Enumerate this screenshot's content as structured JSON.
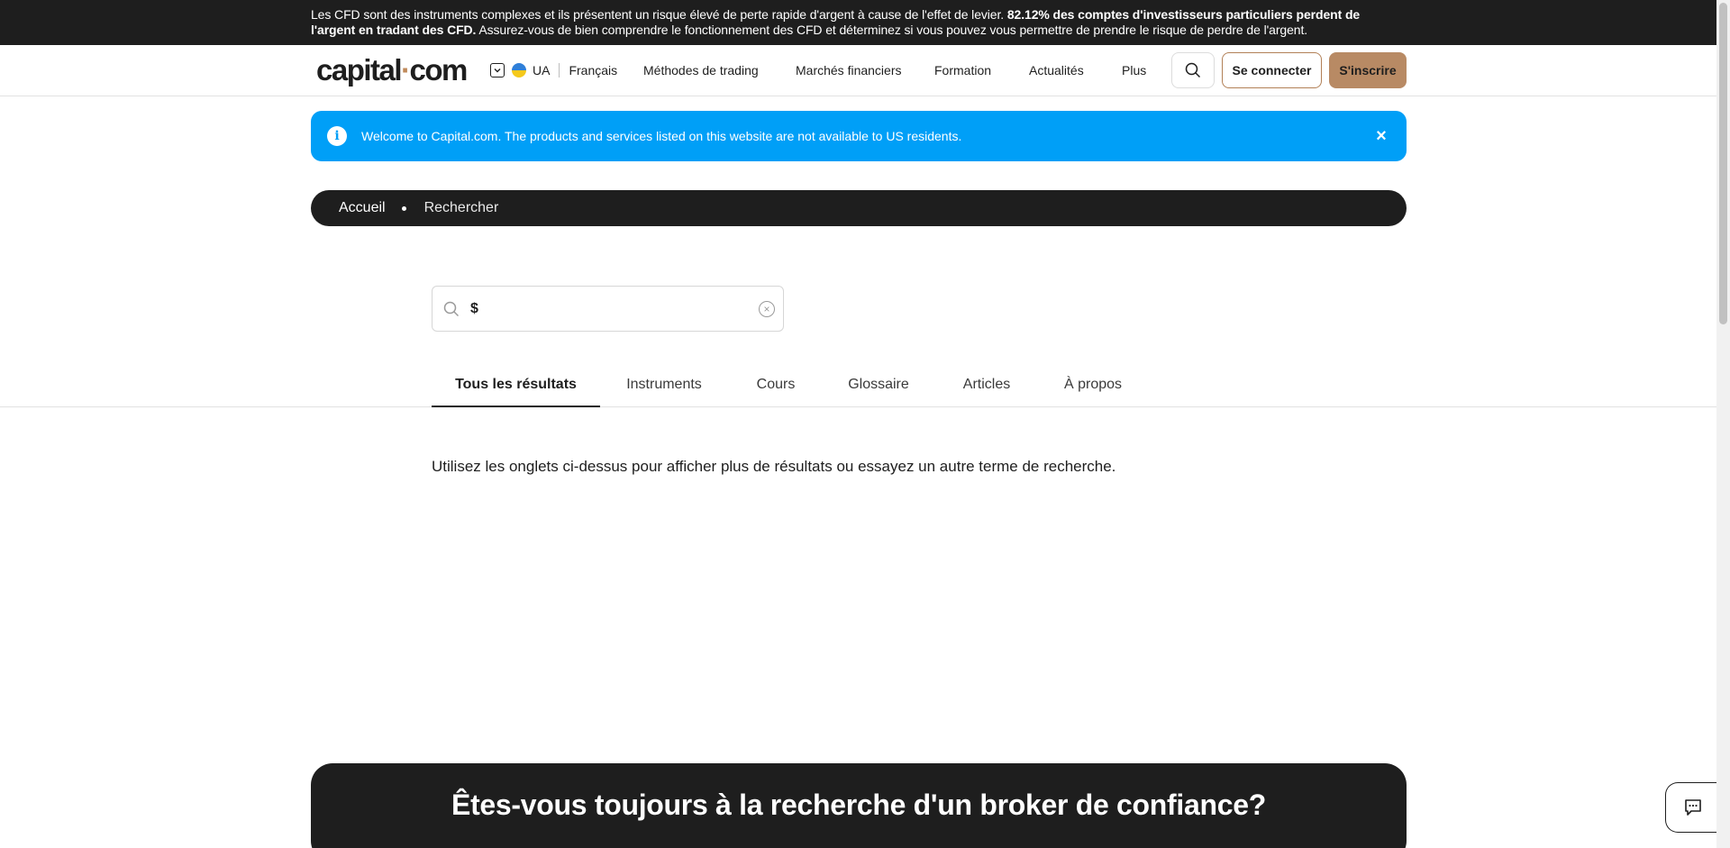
{
  "risk_banner": {
    "text_1": "Les CFD sont des instruments complexes et ils présentent un risque élevé de perte rapide d'argent à cause de l'effet de levier. ",
    "bold": "82.12% des comptes d'investisseurs particuliers perdent de l'argent en tradant des CFD.",
    "text_2": " Assurez-vous de bien comprendre le fonctionnement des CFD et déterminez si vous pouvez vous permettre de prendre le risque de perdre de l'argent."
  },
  "header": {
    "logo_part1": "capital",
    "logo_dot": "·",
    "logo_part2": "com",
    "region_code": "UA",
    "language": "Français",
    "nav": [
      "Méthodes de trading",
      "Marchés financiers",
      "Formation",
      "Actualités",
      "Plus"
    ],
    "login_label": "Se connecter",
    "signup_label": "S'inscrire"
  },
  "notice": {
    "text": "Welcome to Capital.com. The products and services listed on this website are not available to US residents.",
    "close_label": "×"
  },
  "breadcrumb": {
    "home": "Accueil",
    "current": "Rechercher"
  },
  "search": {
    "value": "$",
    "clear_label": "×"
  },
  "tabs": [
    "Tous les résultats",
    "Instruments",
    "Cours",
    "Glossaire",
    "Articles",
    "À propos"
  ],
  "hint": "Utilisez les onglets ci-dessus pour afficher plus de résultats ou essayez un autre terme de recherche.",
  "cta": {
    "title": "Êtes-vous toujours à la recherche d'un broker de confiance?"
  },
  "colors": {
    "accent": "#b88a64",
    "info_blue": "#009ff7",
    "dark": "#1e1e1e"
  }
}
